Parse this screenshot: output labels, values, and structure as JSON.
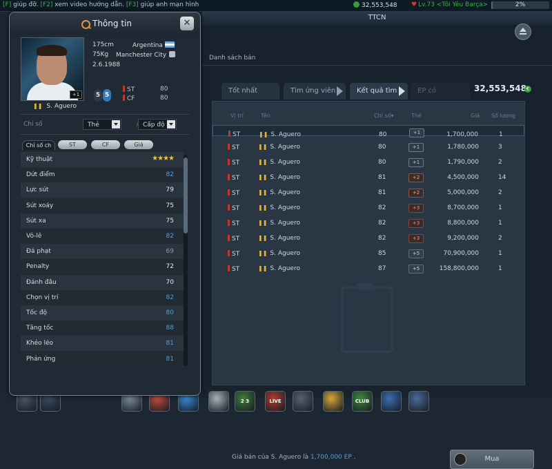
{
  "topbar": {
    "ticker_a": "[F]",
    "ticker_b": " giúp đỡ. ",
    "ticker_c": "[F2]",
    "ticker_d": " xem video hướng dẫn. ",
    "ticker_e": "[F3]",
    "ticker_f": " giúp anh mạn hình",
    "money": "32,553,548",
    "level": "Lv.73 <Tôi Yêu Barça>",
    "xp_percent": "2%",
    "xp_fraction": 0.02
  },
  "window": {
    "title": "TTCN",
    "subtab": "Danh sách bán",
    "tabs": [
      "Tốt nhất tuần",
      "Tìm ứng viên",
      "Kết quả tìm",
      "EP có"
    ],
    "ep_value": "32,553,548",
    "ep_coin": "€",
    "columns": [
      "Vị trí",
      "Tên",
      "Chỉ số",
      "Thẻ",
      "Giá",
      "Số lượng"
    ],
    "rows": [
      {
        "pos": "ST",
        "name": "S. Aguero",
        "ovr": "80",
        "card": "+1",
        "price": "1,700,000",
        "qty": "1"
      },
      {
        "pos": "ST",
        "name": "S. Aguero",
        "ovr": "80",
        "card": "+1",
        "price": "1,780,000",
        "qty": "3"
      },
      {
        "pos": "ST",
        "name": "S. Aguero",
        "ovr": "80",
        "card": "+1",
        "price": "1,790,000",
        "qty": "2"
      },
      {
        "pos": "ST",
        "name": "S. Aguero",
        "ovr": "81",
        "card": "+2",
        "price": "4,500,000",
        "qty": "14"
      },
      {
        "pos": "ST",
        "name": "S. Aguero",
        "ovr": "81",
        "card": "+2",
        "price": "5,000,000",
        "qty": "2"
      },
      {
        "pos": "ST",
        "name": "S. Aguero",
        "ovr": "82",
        "card": "+3",
        "price": "8,700,000",
        "qty": "1"
      },
      {
        "pos": "ST",
        "name": "S. Aguero",
        "ovr": "82",
        "card": "+3",
        "price": "8,800,000",
        "qty": "1"
      },
      {
        "pos": "ST",
        "name": "S. Aguero",
        "ovr": "82",
        "card": "+3",
        "price": "9,200,000",
        "qty": "2"
      },
      {
        "pos": "ST",
        "name": "S. Aguero",
        "ovr": "85",
        "card": "+5",
        "price": "70,900,000",
        "qty": "1"
      },
      {
        "pos": "ST",
        "name": "S. Aguero",
        "ovr": "87",
        "card": "+5",
        "price": "158,800,000",
        "qty": "1"
      }
    ],
    "bottom_prefix": "Giá bán của S. Aguero là ",
    "bottom_value": "1,700,000 EP",
    "bottom_suffix": " .",
    "buy_label": "Mua"
  },
  "info": {
    "title": "Thông tin",
    "close": "✕",
    "height": "175cm",
    "weight": "75Kg",
    "dob": "2.6.1988",
    "nation": "Argentina",
    "club": "Manchester City",
    "name": "S. Aguero",
    "card_badge": "+1",
    "ovr_a": "5",
    "ovr_b": "5",
    "positions": [
      {
        "pos": "ST",
        "rate": "80"
      },
      {
        "pos": "CF",
        "rate": "80"
      }
    ],
    "filter_label": "Chỉ số",
    "select_card": "Thẻ",
    "select_level": "Cấp độ",
    "slash": "/",
    "pills": [
      "Chỉ số ch",
      "ST",
      "CF",
      "Giá"
    ],
    "attributes": [
      {
        "name": "Kỹ thuật",
        "value": "★★★★",
        "type": "stars"
      },
      {
        "name": "Dứt điểm",
        "value": "82",
        "type": "blue"
      },
      {
        "name": "Lực sút",
        "value": "79",
        "type": "white"
      },
      {
        "name": "Sút xoáy",
        "value": "75",
        "type": "white"
      },
      {
        "name": "Sút xa",
        "value": "75",
        "type": "white"
      },
      {
        "name": "Vô-lê",
        "value": "82",
        "type": "blue"
      },
      {
        "name": "Đá phạt",
        "value": "69",
        "type": "gray"
      },
      {
        "name": "Penalty",
        "value": "72",
        "type": "white"
      },
      {
        "name": "Đánh đầu",
        "value": "70",
        "type": "white"
      },
      {
        "name": "Chọn vị trí",
        "value": "82",
        "type": "blue"
      },
      {
        "name": "Tốc độ",
        "value": "80",
        "type": "blue"
      },
      {
        "name": "Tăng tốc",
        "value": "88",
        "type": "blue"
      },
      {
        "name": "Khéo léo",
        "value": "81",
        "type": "blue"
      },
      {
        "name": "Phản ứng",
        "value": "81",
        "type": "blue"
      }
    ]
  },
  "dock": {
    "icons": [
      "home-icon",
      "chat-icon",
      "boot-icon",
      "ball-icon",
      "cleat-icon",
      "trophy-icon",
      "ranking-icon",
      "live-icon",
      "notepad-icon",
      "shirt-icon",
      "club-icon",
      "flag-icon",
      "cart-icon"
    ],
    "live_label": "LIVE",
    "club_label": "CLUB",
    "rank_label": "2 3"
  },
  "colors": {
    "accent_blue": "#4ea0e0",
    "gold": "#f0c33a",
    "green": "#3fae4a",
    "red": "#c0392b"
  }
}
